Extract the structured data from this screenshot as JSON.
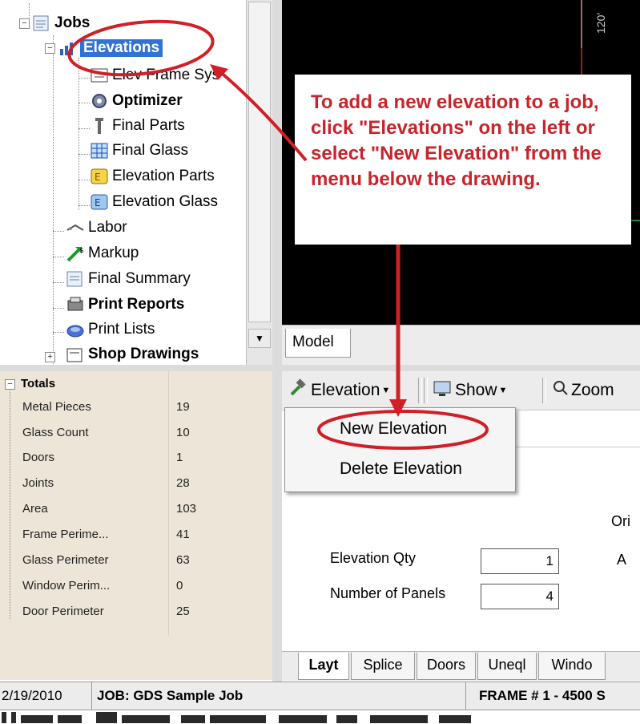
{
  "tree": {
    "items": [
      {
        "label": "Jobs",
        "icon": "jobs-icon",
        "bold": true
      },
      {
        "label": "Elevations",
        "icon": "elevations-icon",
        "bold": true,
        "selected": true
      },
      {
        "label": "Elev Frame Sys",
        "icon": "frame-sys-icon",
        "bold": false
      },
      {
        "label": "Optimizer",
        "icon": "optimizer-icon",
        "bold": true
      },
      {
        "label": "Final Parts",
        "icon": "final-parts-icon",
        "bold": false
      },
      {
        "label": "Final Glass",
        "icon": "final-glass-icon",
        "bold": false
      },
      {
        "label": "Elevation Parts",
        "icon": "elevation-parts-icon",
        "bold": false
      },
      {
        "label": "Elevation Glass",
        "icon": "elevation-glass-icon",
        "bold": false
      },
      {
        "label": "Labor",
        "icon": "labor-icon",
        "bold": false
      },
      {
        "label": "Markup",
        "icon": "markup-icon",
        "bold": false
      },
      {
        "label": "Final Summary",
        "icon": "final-summary-icon",
        "bold": false
      },
      {
        "label": "Print Reports",
        "icon": "print-reports-icon",
        "bold": true
      },
      {
        "label": "Print Lists",
        "icon": "print-lists-icon",
        "bold": false
      },
      {
        "label": "Shop Drawings",
        "icon": "shop-drawings-icon",
        "bold": true
      }
    ]
  },
  "drawing": {
    "ruler_label": "120'",
    "model_tab": "Model"
  },
  "callout": {
    "text": "To add a new elevation to a job, click \"Elevations\" on the left or select \"New Elevation\" from the menu below the drawing.",
    "color": "#c8242b"
  },
  "totals": {
    "header": "Totals",
    "rows": [
      {
        "label": "Metal Pieces",
        "value": "19"
      },
      {
        "label": "Glass Count",
        "value": "10"
      },
      {
        "label": "Doors",
        "value": "1"
      },
      {
        "label": "Joints",
        "value": "28"
      },
      {
        "label": "Area",
        "value": "103"
      },
      {
        "label": "Frame Perime...",
        "value": "41"
      },
      {
        "label": "Glass Perimeter",
        "value": "63"
      },
      {
        "label": "Window Perim...",
        "value": "0"
      },
      {
        "label": "Door Perimeter",
        "value": "25"
      }
    ]
  },
  "toolbar": {
    "elevation_label": "Elevation",
    "show_label": "Show",
    "zoom_label": "Zoom"
  },
  "dropdown": {
    "items": [
      "New Elevation",
      "Delete Elevation"
    ]
  },
  "form": {
    "elevation_qty_label": "Elevation Qty",
    "elevation_qty_value": "1",
    "panels_label": "Number of Panels",
    "panels_value": "4",
    "right_label_1": "Ori",
    "right_label_2": "A"
  },
  "bottom_tabs": [
    "Layt",
    "Splice",
    "Doors",
    "Uneql",
    "Windo"
  ],
  "status_bar": {
    "date": "2/19/2010",
    "job": "JOB:  GDS Sample Job",
    "frame": "FRAME # 1 - 4500 S"
  },
  "colors": {
    "annotation_red": "#d21f27",
    "drawing_bg": "#000000",
    "totals_bg": "#ede6d8"
  }
}
